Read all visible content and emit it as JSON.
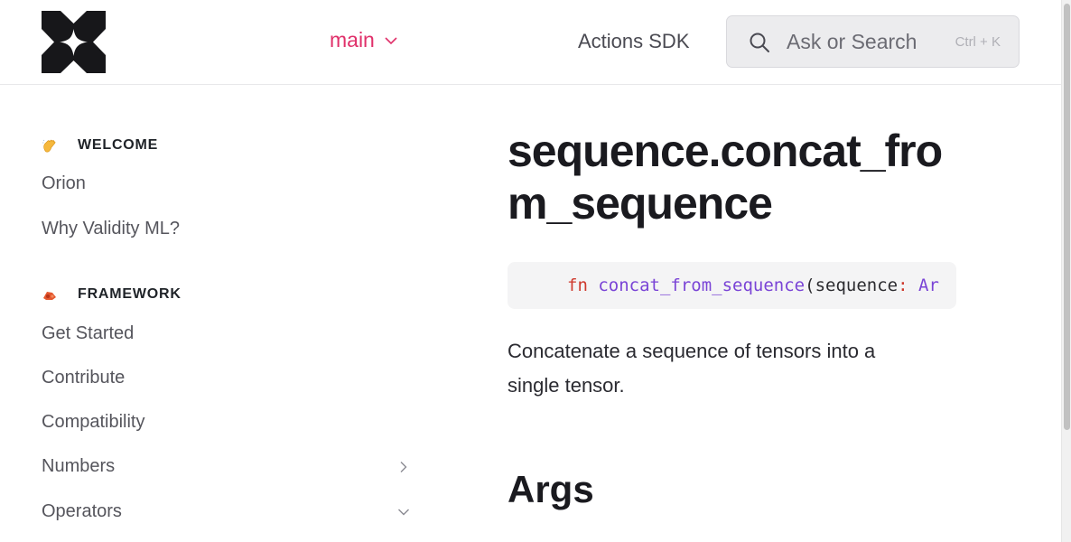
{
  "header": {
    "branch_label": "main",
    "nav_link": "Actions SDK",
    "search": {
      "placeholder": "Ask or Search",
      "shortcut": "Ctrl + K"
    }
  },
  "sidebar": {
    "sections": [
      {
        "title": "WELCOME",
        "icon": "waving-hand-icon",
        "items": [
          {
            "label": "Orion"
          },
          {
            "label": "Why Validity ML?"
          }
        ]
      },
      {
        "title": "FRAMEWORK",
        "icon": "framework-icon",
        "items": [
          {
            "label": "Get Started"
          },
          {
            "label": "Contribute"
          },
          {
            "label": "Compatibility"
          },
          {
            "label": "Numbers",
            "chevron": "chevron-right-icon"
          },
          {
            "label": "Operators",
            "chevron": "chevron-down-icon"
          }
        ]
      }
    ]
  },
  "main": {
    "title": "sequence.concat_from_sequence",
    "code": {
      "keyword": "fn",
      "function_name": "concat_from_sequence",
      "open_paren": "(",
      "param": "sequence",
      "colon": ":",
      "type_fragment": "Ar"
    },
    "description": "Concatenate a sequence of tensors into a single tensor.",
    "args_heading": "Args"
  },
  "colors": {
    "accent": "#e0306a",
    "code_keyword": "#cf3a2e",
    "code_function": "#7a44d6"
  }
}
